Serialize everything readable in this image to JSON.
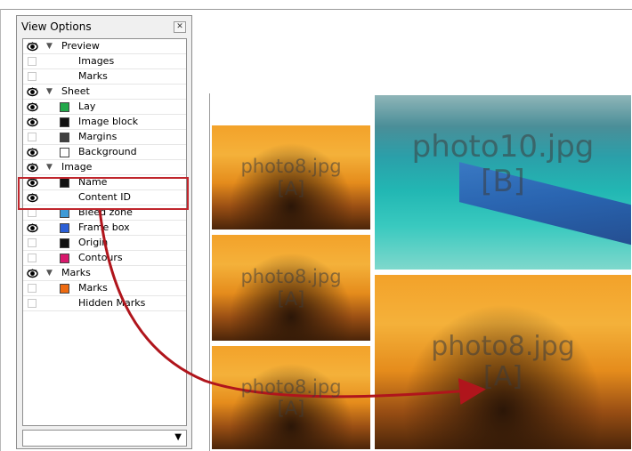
{
  "panel": {
    "title": "View Options",
    "close_icon": "close-x-icon",
    "rows": [
      {
        "type": "category",
        "eye": true,
        "label": "Preview"
      },
      {
        "type": "item",
        "eye": false,
        "label": "Images",
        "swatch": null
      },
      {
        "type": "item",
        "eye": false,
        "label": "Marks",
        "swatch": null
      },
      {
        "type": "category",
        "eye": true,
        "label": "Sheet"
      },
      {
        "type": "item",
        "eye": true,
        "label": "Lay",
        "swatch": "#22a84a"
      },
      {
        "type": "item",
        "eye": true,
        "label": "Image block",
        "swatch": "#111111"
      },
      {
        "type": "item",
        "eye": false,
        "label": "Margins",
        "swatch": "#404040"
      },
      {
        "type": "item",
        "eye": true,
        "label": "Background",
        "swatch": "#ffffff"
      },
      {
        "type": "category",
        "eye": true,
        "label": "Image"
      },
      {
        "type": "item",
        "eye": true,
        "label": "Name",
        "swatch": "#111111"
      },
      {
        "type": "item",
        "eye": true,
        "label": "Content ID",
        "swatch": null
      },
      {
        "type": "item",
        "eye": false,
        "label": "Bleed zone",
        "swatch": "#3d9ad6"
      },
      {
        "type": "item",
        "eye": true,
        "label": "Frame box",
        "swatch": "#2b5fd6"
      },
      {
        "type": "item",
        "eye": false,
        "label": "Origin",
        "swatch": "#111111"
      },
      {
        "type": "item",
        "eye": false,
        "label": "Contours",
        "swatch": "#d8186c"
      },
      {
        "type": "category",
        "eye": true,
        "label": "Marks"
      },
      {
        "type": "item",
        "eye": false,
        "label": "Marks",
        "swatch": "#ee6a10"
      },
      {
        "type": "item",
        "eye": false,
        "label": "Hidden Marks",
        "swatch": null
      }
    ],
    "dropdown": {
      "value": "",
      "arrow": "▼"
    }
  },
  "photos": [
    {
      "name": "photo8.jpg",
      "id": "[A]"
    },
    {
      "name": "photo10.jpg",
      "id": "[B]"
    },
    {
      "name": "photo8.jpg",
      "id": "[A]"
    },
    {
      "name": "photo8.jpg",
      "id": "[A]"
    },
    {
      "name": "photo8.jpg",
      "id": "[A]"
    }
  ],
  "colors": {
    "highlight": "#c0262d",
    "arrow": "#b0151c"
  }
}
